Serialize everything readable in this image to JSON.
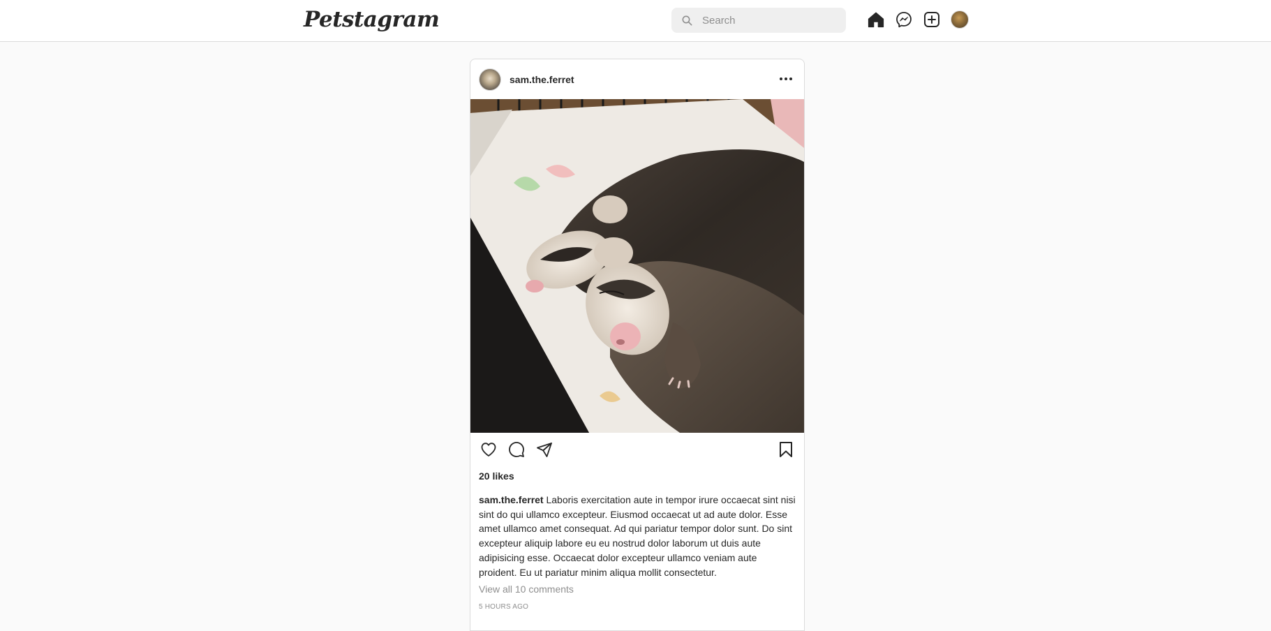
{
  "header": {
    "logo": "Petstagram",
    "search_placeholder": "Search",
    "icons": [
      "home-icon",
      "messenger-icon",
      "new-post-icon",
      "profile-avatar"
    ]
  },
  "post": {
    "username": "sam.the.ferret",
    "image_description_icon": "two-sleeping-ferrets-photo",
    "likes": "20 likes",
    "caption_user": "sam.the.ferret",
    "caption_text": " Laboris exercitation aute in tempor irure occaecat sint nisi sint do qui ullamco excepteur. Eiusmod occaecat ut ad aute dolor. Esse amet ullamco amet consequat. Ad qui pariatur tempor dolor sunt. Do sint excepteur aliquip labore eu eu nostrud dolor laborum ut duis aute adipisicing esse. Occaecat dolor excepteur ullamco veniam aute proident. Eu ut pariatur minim aliqua mollit consectetur.",
    "view_comments": "View all 10 comments",
    "timestamp": "5 HOURS AGO"
  },
  "colors": {
    "background": "#fafafa",
    "card": "#ffffff",
    "border": "#dbdbdb",
    "text": "#262626",
    "muted": "#8e8e8e",
    "search_bg": "#efefef"
  }
}
